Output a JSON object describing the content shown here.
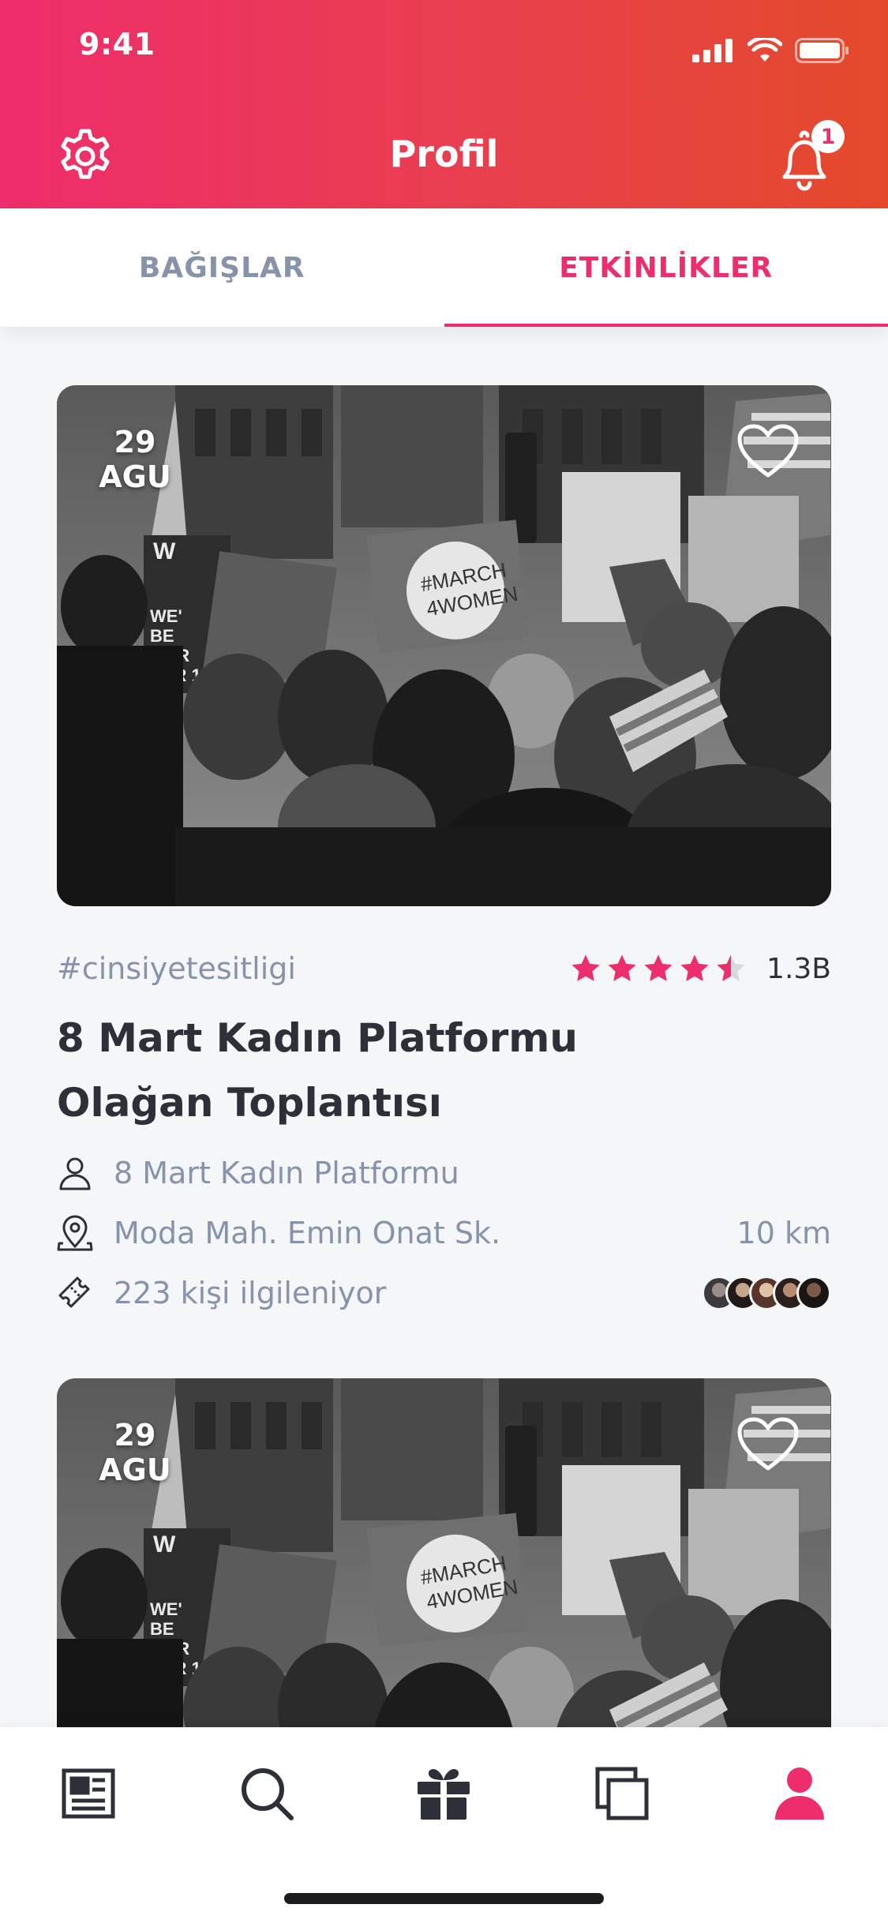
{
  "status_bar": {
    "time": "9:41"
  },
  "header": {
    "title": "Profil",
    "notification_count": "1"
  },
  "tabs": [
    {
      "label": "BAĞIŞLAR",
      "active": false
    },
    {
      "label": "ETKİNLİKLER",
      "active": true
    }
  ],
  "events": [
    {
      "date_day": "29",
      "date_month": "AGU",
      "hashtag": "#cinsiyetesitligi",
      "rating": 4.5,
      "rating_count": "1.3B",
      "title_line1": "8 Mart Kadın Platformu",
      "title_line2": "Olağan Toplantısı",
      "organizer": "8 Mart Kadın Platformu",
      "location": "Moda Mah. Emin Onat Sk.",
      "distance": "10 km",
      "interested": "223 kişi ilgileniyor",
      "image_sign_text": "#MARCH 4WOMEN"
    },
    {
      "date_day": "29",
      "date_month": "AGU",
      "image_sign_text": "#MARCH 4WOMEN"
    }
  ],
  "bottom_nav": [
    {
      "icon": "news-icon",
      "active": false
    },
    {
      "icon": "search-icon",
      "active": false
    },
    {
      "icon": "gift-icon",
      "active": false
    },
    {
      "icon": "copy-icon",
      "active": false
    },
    {
      "icon": "profile-icon",
      "active": true
    }
  ],
  "colors": {
    "accent": "#ee2d6c",
    "header_gradient_start": "#ee2d6c",
    "header_gradient_end": "#e44a2a",
    "muted_text": "#8793ab",
    "dark_text": "#2d2f39"
  }
}
